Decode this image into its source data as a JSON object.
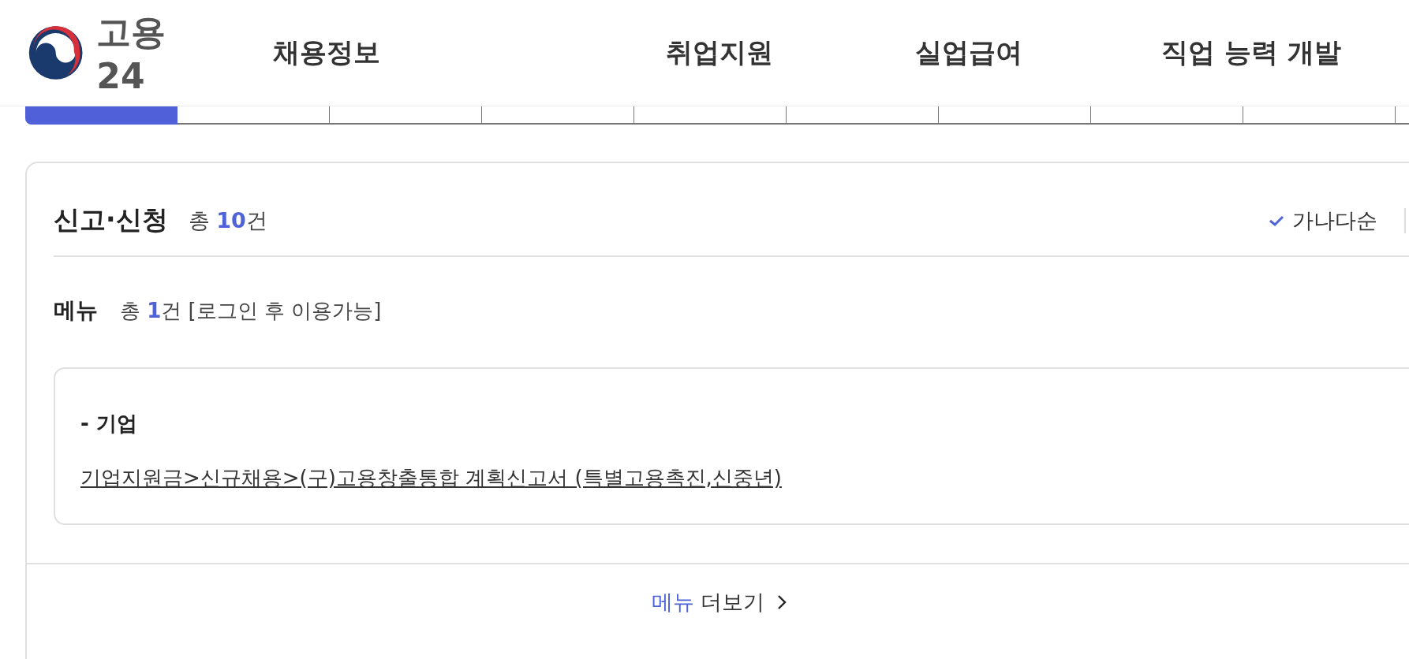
{
  "header": {
    "logo_text": "고용24",
    "nav": [
      "채용정보",
      "취업지원",
      "실업급여",
      "직업 능력 개발"
    ]
  },
  "tabs": [
    {
      "selected": true
    },
    {
      "selected": false
    },
    {
      "selected": false
    },
    {
      "selected": false
    },
    {
      "selected": false
    },
    {
      "selected": false
    },
    {
      "selected": false
    },
    {
      "selected": false
    },
    {
      "selected": false
    },
    {
      "selected": false
    }
  ],
  "section": {
    "title": "신고·신청",
    "count": "총 **10**건",
    "sort": {
      "label": "가나다순",
      "selected": true
    }
  },
  "menu": {
    "title": "메뉴",
    "count": "총 **1**건 [로그인 후 이용가능]",
    "group": "- 기업",
    "link": "기업지원금>신규채용>(구)고용창출통합 계획신고서 (특별고용촉진,신중년)",
    "more_keyword": "메뉴",
    "more_label": "더보기"
  }
}
